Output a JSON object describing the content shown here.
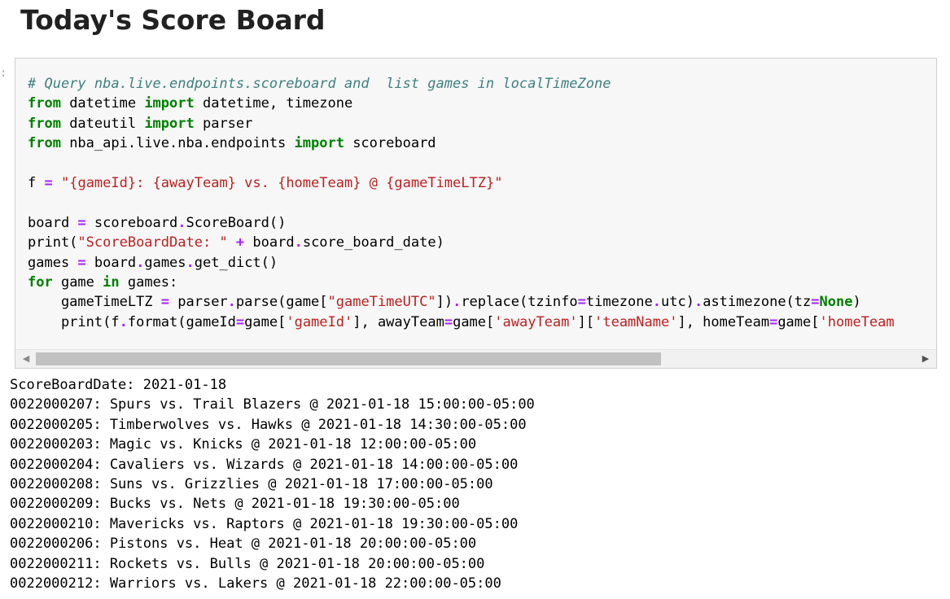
{
  "heading": "Today's Score Board",
  "prompt": ":",
  "code_lines": [
    [
      {
        "t": "cm",
        "v": "# Query nba.live.endpoints.scoreboard and  list games in localTimeZone"
      }
    ],
    [
      {
        "t": "kw",
        "v": "from"
      },
      {
        "t": "pl",
        "v": " datetime "
      },
      {
        "t": "kw",
        "v": "import"
      },
      {
        "t": "pl",
        "v": " datetime, timezone"
      }
    ],
    [
      {
        "t": "kw",
        "v": "from"
      },
      {
        "t": "pl",
        "v": " dateutil "
      },
      {
        "t": "kw",
        "v": "import"
      },
      {
        "t": "pl",
        "v": " parser"
      }
    ],
    [
      {
        "t": "kw",
        "v": "from"
      },
      {
        "t": "pl",
        "v": " nba_api.live.nba.endpoints "
      },
      {
        "t": "kw",
        "v": "import"
      },
      {
        "t": "pl",
        "v": " scoreboard"
      }
    ],
    [],
    [
      {
        "t": "pl",
        "v": "f "
      },
      {
        "t": "op",
        "v": "="
      },
      {
        "t": "pl",
        "v": " "
      },
      {
        "t": "st",
        "v": "\"{gameId}: {awayTeam} vs. {homeTeam} @ {gameTimeLTZ}\""
      }
    ],
    [],
    [
      {
        "t": "pl",
        "v": "board "
      },
      {
        "t": "op",
        "v": "="
      },
      {
        "t": "pl",
        "v": " scoreboard"
      },
      {
        "t": "op",
        "v": "."
      },
      {
        "t": "pl",
        "v": "ScoreBoard()"
      }
    ],
    [
      {
        "t": "pl",
        "v": "print("
      },
      {
        "t": "st",
        "v": "\"ScoreBoardDate: \""
      },
      {
        "t": "pl",
        "v": " "
      },
      {
        "t": "op",
        "v": "+"
      },
      {
        "t": "pl",
        "v": " board"
      },
      {
        "t": "op",
        "v": "."
      },
      {
        "t": "pl",
        "v": "score_board_date)"
      }
    ],
    [
      {
        "t": "pl",
        "v": "games "
      },
      {
        "t": "op",
        "v": "="
      },
      {
        "t": "pl",
        "v": " board"
      },
      {
        "t": "op",
        "v": "."
      },
      {
        "t": "pl",
        "v": "games"
      },
      {
        "t": "op",
        "v": "."
      },
      {
        "t": "pl",
        "v": "get_dict()"
      }
    ],
    [
      {
        "t": "kw",
        "v": "for"
      },
      {
        "t": "pl",
        "v": " game "
      },
      {
        "t": "kw",
        "v": "in"
      },
      {
        "t": "pl",
        "v": " games:"
      }
    ],
    [
      {
        "t": "pl",
        "v": "    gameTimeLTZ "
      },
      {
        "t": "op",
        "v": "="
      },
      {
        "t": "pl",
        "v": " parser"
      },
      {
        "t": "op",
        "v": "."
      },
      {
        "t": "pl",
        "v": "parse(game["
      },
      {
        "t": "st",
        "v": "\"gameTimeUTC\""
      },
      {
        "t": "pl",
        "v": "])"
      },
      {
        "t": "op",
        "v": "."
      },
      {
        "t": "pl",
        "v": "replace(tzinfo"
      },
      {
        "t": "op",
        "v": "="
      },
      {
        "t": "pl",
        "v": "timezone"
      },
      {
        "t": "op",
        "v": "."
      },
      {
        "t": "pl",
        "v": "utc)"
      },
      {
        "t": "op",
        "v": "."
      },
      {
        "t": "pl",
        "v": "astimezone(tz"
      },
      {
        "t": "op",
        "v": "="
      },
      {
        "t": "kw",
        "v": "None"
      },
      {
        "t": "pl",
        "v": ")"
      }
    ],
    [
      {
        "t": "pl",
        "v": "    print(f"
      },
      {
        "t": "op",
        "v": "."
      },
      {
        "t": "pl",
        "v": "format(gameId"
      },
      {
        "t": "op",
        "v": "="
      },
      {
        "t": "pl",
        "v": "game["
      },
      {
        "t": "st",
        "v": "'gameId'"
      },
      {
        "t": "pl",
        "v": "], awayTeam"
      },
      {
        "t": "op",
        "v": "="
      },
      {
        "t": "pl",
        "v": "game["
      },
      {
        "t": "st",
        "v": "'awayTeam'"
      },
      {
        "t": "pl",
        "v": "]["
      },
      {
        "t": "st",
        "v": "'teamName'"
      },
      {
        "t": "pl",
        "v": "], homeTeam"
      },
      {
        "t": "op",
        "v": "="
      },
      {
        "t": "pl",
        "v": "game["
      },
      {
        "t": "st",
        "v": "'homeTeam"
      }
    ]
  ],
  "scrollbar": {
    "left_arrow": "◀",
    "right_arrow": "▶",
    "visible_fraction": 0.71
  },
  "output_lines": [
    "ScoreBoardDate: 2021-01-18",
    "0022000207: Spurs vs. Trail Blazers @ 2021-01-18 15:00:00-05:00",
    "0022000205: Timberwolves vs. Hawks @ 2021-01-18 14:30:00-05:00",
    "0022000203: Magic vs. Knicks @ 2021-01-18 12:00:00-05:00",
    "0022000204: Cavaliers vs. Wizards @ 2021-01-18 14:00:00-05:00",
    "0022000208: Suns vs. Grizzlies @ 2021-01-18 17:00:00-05:00",
    "0022000209: Bucks vs. Nets @ 2021-01-18 19:30:00-05:00",
    "0022000210: Mavericks vs. Raptors @ 2021-01-18 19:30:00-05:00",
    "0022000206: Pistons vs. Heat @ 2021-01-18 20:00:00-05:00",
    "0022000211: Rockets vs. Bulls @ 2021-01-18 20:00:00-05:00",
    "0022000212: Warriors vs. Lakers @ 2021-01-18 22:00:00-05:00"
  ],
  "colors": {
    "comment": "#408080",
    "keyword": "#008000",
    "string": "#ba2121",
    "operator": "#aa22ff",
    "cell_background": "#f7f7f7"
  }
}
